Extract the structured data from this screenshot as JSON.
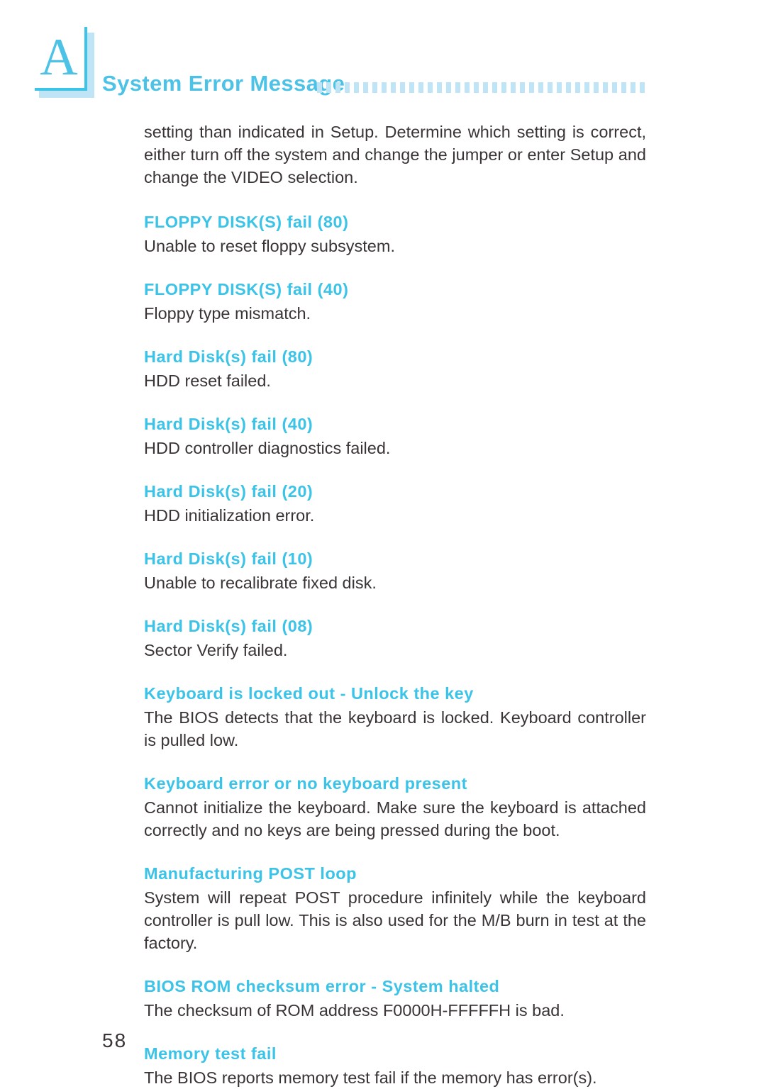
{
  "header": {
    "chapter_letter": "A",
    "title": "System Error Message",
    "dot_count": 36,
    "accent_color": "#3cc3e8",
    "accent_light_color": "#bfe4f6"
  },
  "body": {
    "intro_paragraph": "setting than indicated in Setup. Determine which setting is correct, either turn off the system and change the jumper or enter Setup and change the VIDEO selection.",
    "entries": [
      {
        "title": "FLOPPY DISK(S) fail (80)",
        "description": "Unable to reset floppy subsystem."
      },
      {
        "title": "FLOPPY DISK(S) fail (40)",
        "description": "Floppy type mismatch."
      },
      {
        "title": "Hard Disk(s) fail (80)",
        "description": "HDD reset failed."
      },
      {
        "title": "Hard Disk(s) fail (40)",
        "description": "HDD controller diagnostics failed."
      },
      {
        "title": "Hard Disk(s) fail (20)",
        "description": "HDD initialization error."
      },
      {
        "title": "Hard Disk(s) fail (10)",
        "description": "Unable to recalibrate fixed disk."
      },
      {
        "title": "Hard Disk(s) fail (08)",
        "description": "Sector Verify failed."
      },
      {
        "title": "Keyboard is locked out - Unlock the key",
        "description": "The BIOS detects that the keyboard is locked. Keyboard controller is pulled low."
      },
      {
        "title": "Keyboard error or no keyboard present",
        "description": "Cannot initialize the keyboard. Make sure the keyboard is attached correctly and no keys are being pressed during the boot."
      },
      {
        "title": "Manufacturing POST loop",
        "description": "System will repeat POST procedure infinitely while the keyboard controller is pull low. This is also used for the M/B burn in test at the factory."
      },
      {
        "title": "BIOS ROM checksum error - System halted",
        "description": "The checksum of ROM address F0000H-FFFFFH is bad."
      },
      {
        "title": "Memory test fail",
        "description": "The BIOS reports memory test fail if the memory has error(s)."
      }
    ]
  },
  "footer": {
    "page_number": "58"
  }
}
